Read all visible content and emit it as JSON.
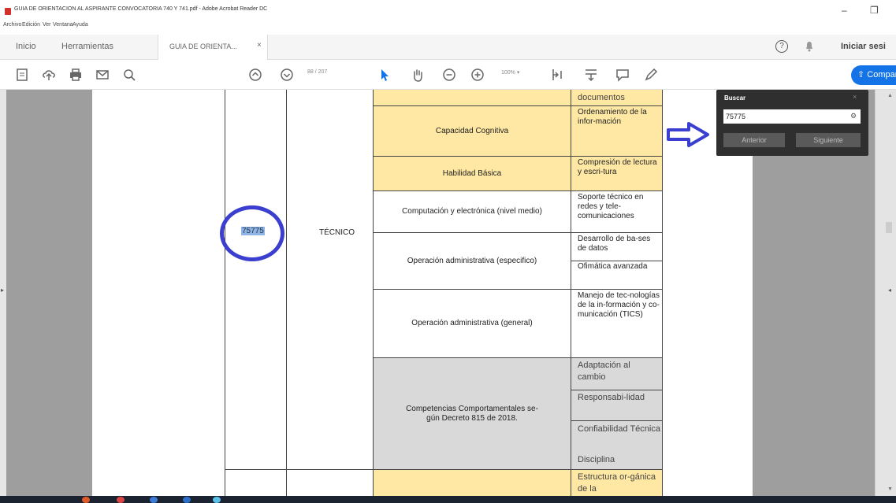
{
  "window": {
    "title": "GUIA DE ORIENTACION AL ASPIRANTE CONVOCATORIA 740 Y 741.pdf - Adobe Acrobat Reader DC",
    "controls": [
      "–",
      "❐"
    ]
  },
  "menu": [
    "Archivo",
    "Edición",
    "Ver",
    "Ventana",
    "Ayuda"
  ],
  "tabs": {
    "home": "Inicio",
    "tools": "Herramientas",
    "document": "GUIA DE ORIENTA...",
    "document_close": "×",
    "help": "?",
    "signin": "Iniciar sesi"
  },
  "toolbar": {
    "page_current": "88",
    "page_total": "/ 207",
    "zoom": "100%",
    "share_label": "Compar"
  },
  "table": {
    "code": "75775",
    "level": "TÉCNICO",
    "rows": [
      {
        "competence": "",
        "subtopics": [
          "documentos"
        ]
      },
      {
        "competence": "Capacidad Cognitiva",
        "subtopics": [
          "Ordenamiento de la infor-mación"
        ]
      },
      {
        "competence": "Habilidad Básica",
        "subtopics": [
          "Compresión de lectura y escri-tura"
        ]
      },
      {
        "competence": "Computación y electrónica (nivel medio)",
        "subtopics": [
          "Soporte técnico en redes y tele-comunicaciones"
        ]
      },
      {
        "competence": "Operación administrativa (especifico)",
        "subtopics": [
          "Desarrollo de ba-ses de datos",
          "Ofimática avanzada"
        ]
      },
      {
        "competence": "Operación administrativa (general)",
        "subtopics": [
          "Manejo de tec-nologías de la in-formación y co-municación (TICS)"
        ]
      },
      {
        "competence": "Competencias Comportamentales se-gún Decreto 815 de 2018.",
        "subtopics": [
          "Adaptación al cambio",
          "Responsabi-lidad",
          "Confiabilidad Técnica",
          "Disciplina"
        ]
      },
      {
        "competence": "",
        "subtopics": [
          "Estructura or-gánica de la"
        ]
      }
    ]
  },
  "search": {
    "label": "Buscar",
    "value": "75775",
    "prev_label": "Anterior",
    "next_label": "Siguiente"
  }
}
